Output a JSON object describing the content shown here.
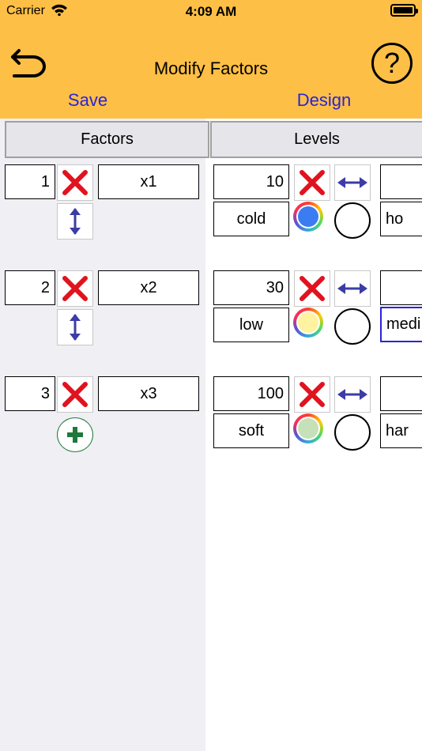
{
  "status_bar": {
    "carrier": "Carrier",
    "time": "4:09 AM"
  },
  "header": {
    "title": "Modify Factors",
    "save_label": "Save",
    "design_label": "Design",
    "help_symbol": "?"
  },
  "columns": {
    "factors": "Factors",
    "levels": "Levels"
  },
  "colors": {
    "header_bg": "#fdbf45",
    "link": "#2a24d6",
    "delete": "#e0131e",
    "arrows": "#3c3ca6",
    "add": "#1e7a3a"
  },
  "factors": [
    {
      "index": "1",
      "name": "x1",
      "level_value": "10",
      "level_low": "cold",
      "level_high_partial": "ho",
      "level_color": "#3b7cf3"
    },
    {
      "index": "2",
      "name": "x2",
      "level_value": "30",
      "level_low": "low",
      "level_high_partial": "medi",
      "level_color": "#fff3a0"
    },
    {
      "index": "3",
      "name": "x3",
      "level_value": "100",
      "level_low": "soft",
      "level_high_partial": "har",
      "level_color": "#c6e0b8"
    }
  ]
}
